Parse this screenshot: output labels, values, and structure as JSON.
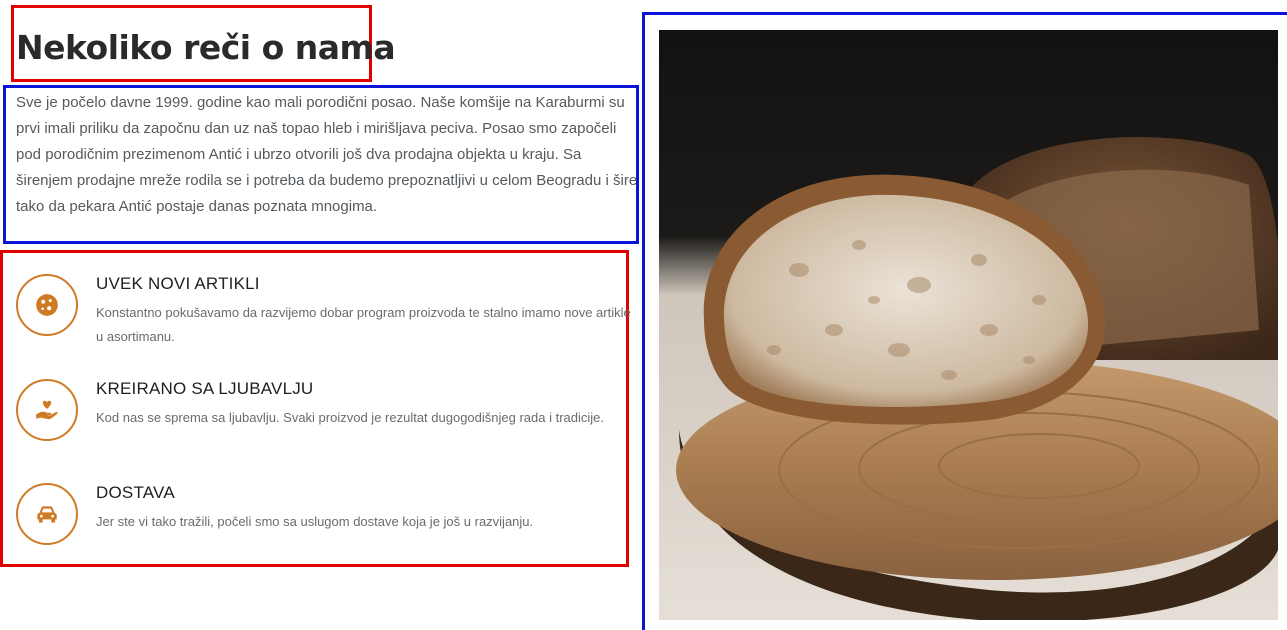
{
  "section": {
    "heading": "Nekoliko reči o nama",
    "intro": "Sve je počelo davne 1999. godine kao mali porodični posao. Naše komšije na Karaburmi su prvi imali priliku da započnu dan uz naš topao hleb i mirišljava peciva. Posao smo započeli pod porodičnim prezimenom Antić i ubrzo otvorili još dva prodajna objekta u kraju. Sa širenjem prodajne mreže rodila se i potreba da budemo prepoznatljivi u celom Beogradu i šire tako da pekara Antić postaje danas poznata mnogima."
  },
  "features": [
    {
      "icon": "cookie-icon",
      "title": "UVEK NOVI ARTIKLI",
      "description": "Konstantno pokušavamo da razvijemo dobar program proizvoda te stalno imamo nove artikle u asortimanu."
    },
    {
      "icon": "hand-heart-icon",
      "title": "KREIRANO SA LJUBAVLJU",
      "description": "Kod nas se sprema sa ljubavlju. Svaki proizvod je rezultat dugogodišnjeg rada i tradicije."
    },
    {
      "icon": "car-icon",
      "title": "DOSTAVA",
      "description": "Jer ste vi tako tražili, počeli smo sa uslugom dostave koja je još u razvijanju."
    }
  ],
  "image": {
    "subject": "bread-on-wooden-board-photo"
  },
  "colors": {
    "accent": "#cf7a25",
    "heading": "#2a2a2a",
    "body_text": "#555a5e",
    "annotation_red": "#e10000",
    "annotation_blue": "#0a14d6"
  }
}
